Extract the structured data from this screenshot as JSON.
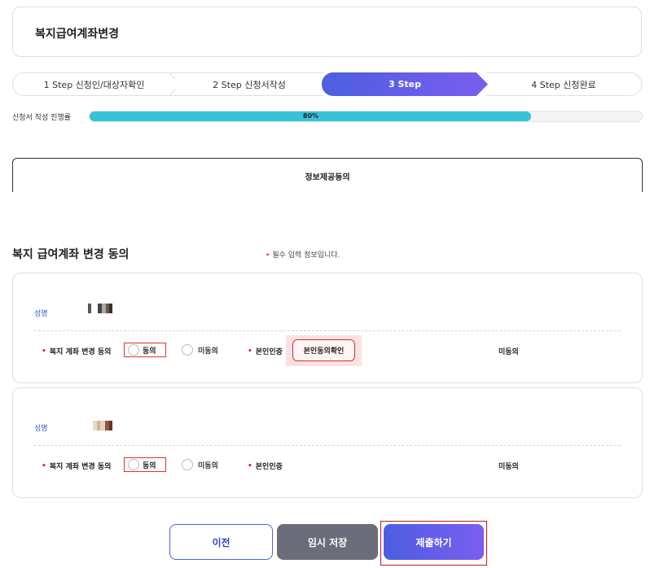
{
  "page": {
    "title": "복지급여계좌변경"
  },
  "steps": [
    {
      "label": "1 Step 신청인/대상자확인"
    },
    {
      "label": "2 Step 신청서작성"
    },
    {
      "label": "3 Step"
    },
    {
      "label": "4 Step 신청완료"
    }
  ],
  "progress": {
    "label": "신청서 작성 진행률",
    "percent": 80,
    "text": "80%"
  },
  "tab": {
    "label": "정보제공동의"
  },
  "section": {
    "title": "복지 급여계좌 변경 동의",
    "required_note": "필수 입력 정보입니다.",
    "required_mark": "•"
  },
  "persons": [
    {
      "name_label": "성명",
      "consent_label": "복지 계좌 변경 동의",
      "agree": "동의",
      "disagree": "미동의",
      "auth_label": "본인인증",
      "verify_button": "본인동의확인",
      "status": "미동의"
    },
    {
      "name_label": "성명",
      "consent_label": "복지 계좌 변경 동의",
      "agree": "동의",
      "disagree": "미동의",
      "auth_label": "본인인증",
      "status": "미동의"
    }
  ],
  "buttons": {
    "prev": "이전",
    "save": "임시 저장",
    "submit": "제출하기"
  },
  "colors": {
    "accent_start": "#4c5fe0",
    "accent_end": "#7a5df0",
    "progress": "#36c3d6",
    "required": "#e02020"
  }
}
